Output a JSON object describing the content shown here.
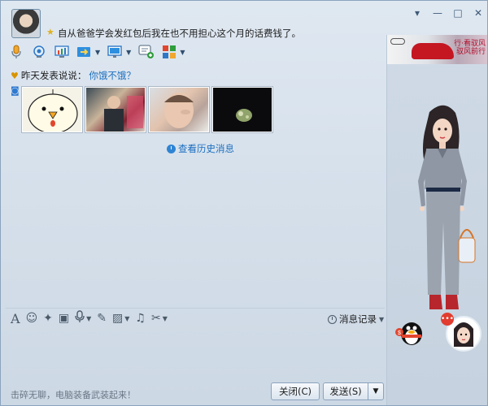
{
  "window": {
    "controls": {
      "menu_glyph": "▾",
      "minimize_glyph": "—",
      "maximize_glyph": "□",
      "close_glyph": "✕"
    }
  },
  "contact": {
    "signature": "自从爸爸学会发红包后我在也不用担心这个月的话费钱了。"
  },
  "toolbar": {
    "icons": [
      "microphone-icon",
      "video-call-icon",
      "remote-assist-icon",
      "file-transfer-icon",
      "screen-share-icon",
      "add-chat-icon",
      "apps-icon"
    ]
  },
  "message_area": {
    "yesterday_label": "昨天发表说说：",
    "yesterday_link": "你饿不饿？",
    "history_link": "查看历史消息"
  },
  "ad": {
    "text_line1": "行·看驭风",
    "text_line2": "驭风前行"
  },
  "input_toolbar": {
    "message_record_label": "消息记录"
  },
  "bottom": {
    "tip": "击碎无聊，电脑装备武装起来！",
    "close_button": "关闭(C)",
    "send_button": "发送(S)",
    "send_dropdown": "▼"
  },
  "colors": {
    "accent_link": "#1a6ec0",
    "window_bg": "#dfe8f1",
    "border": "#8aa3bd"
  }
}
